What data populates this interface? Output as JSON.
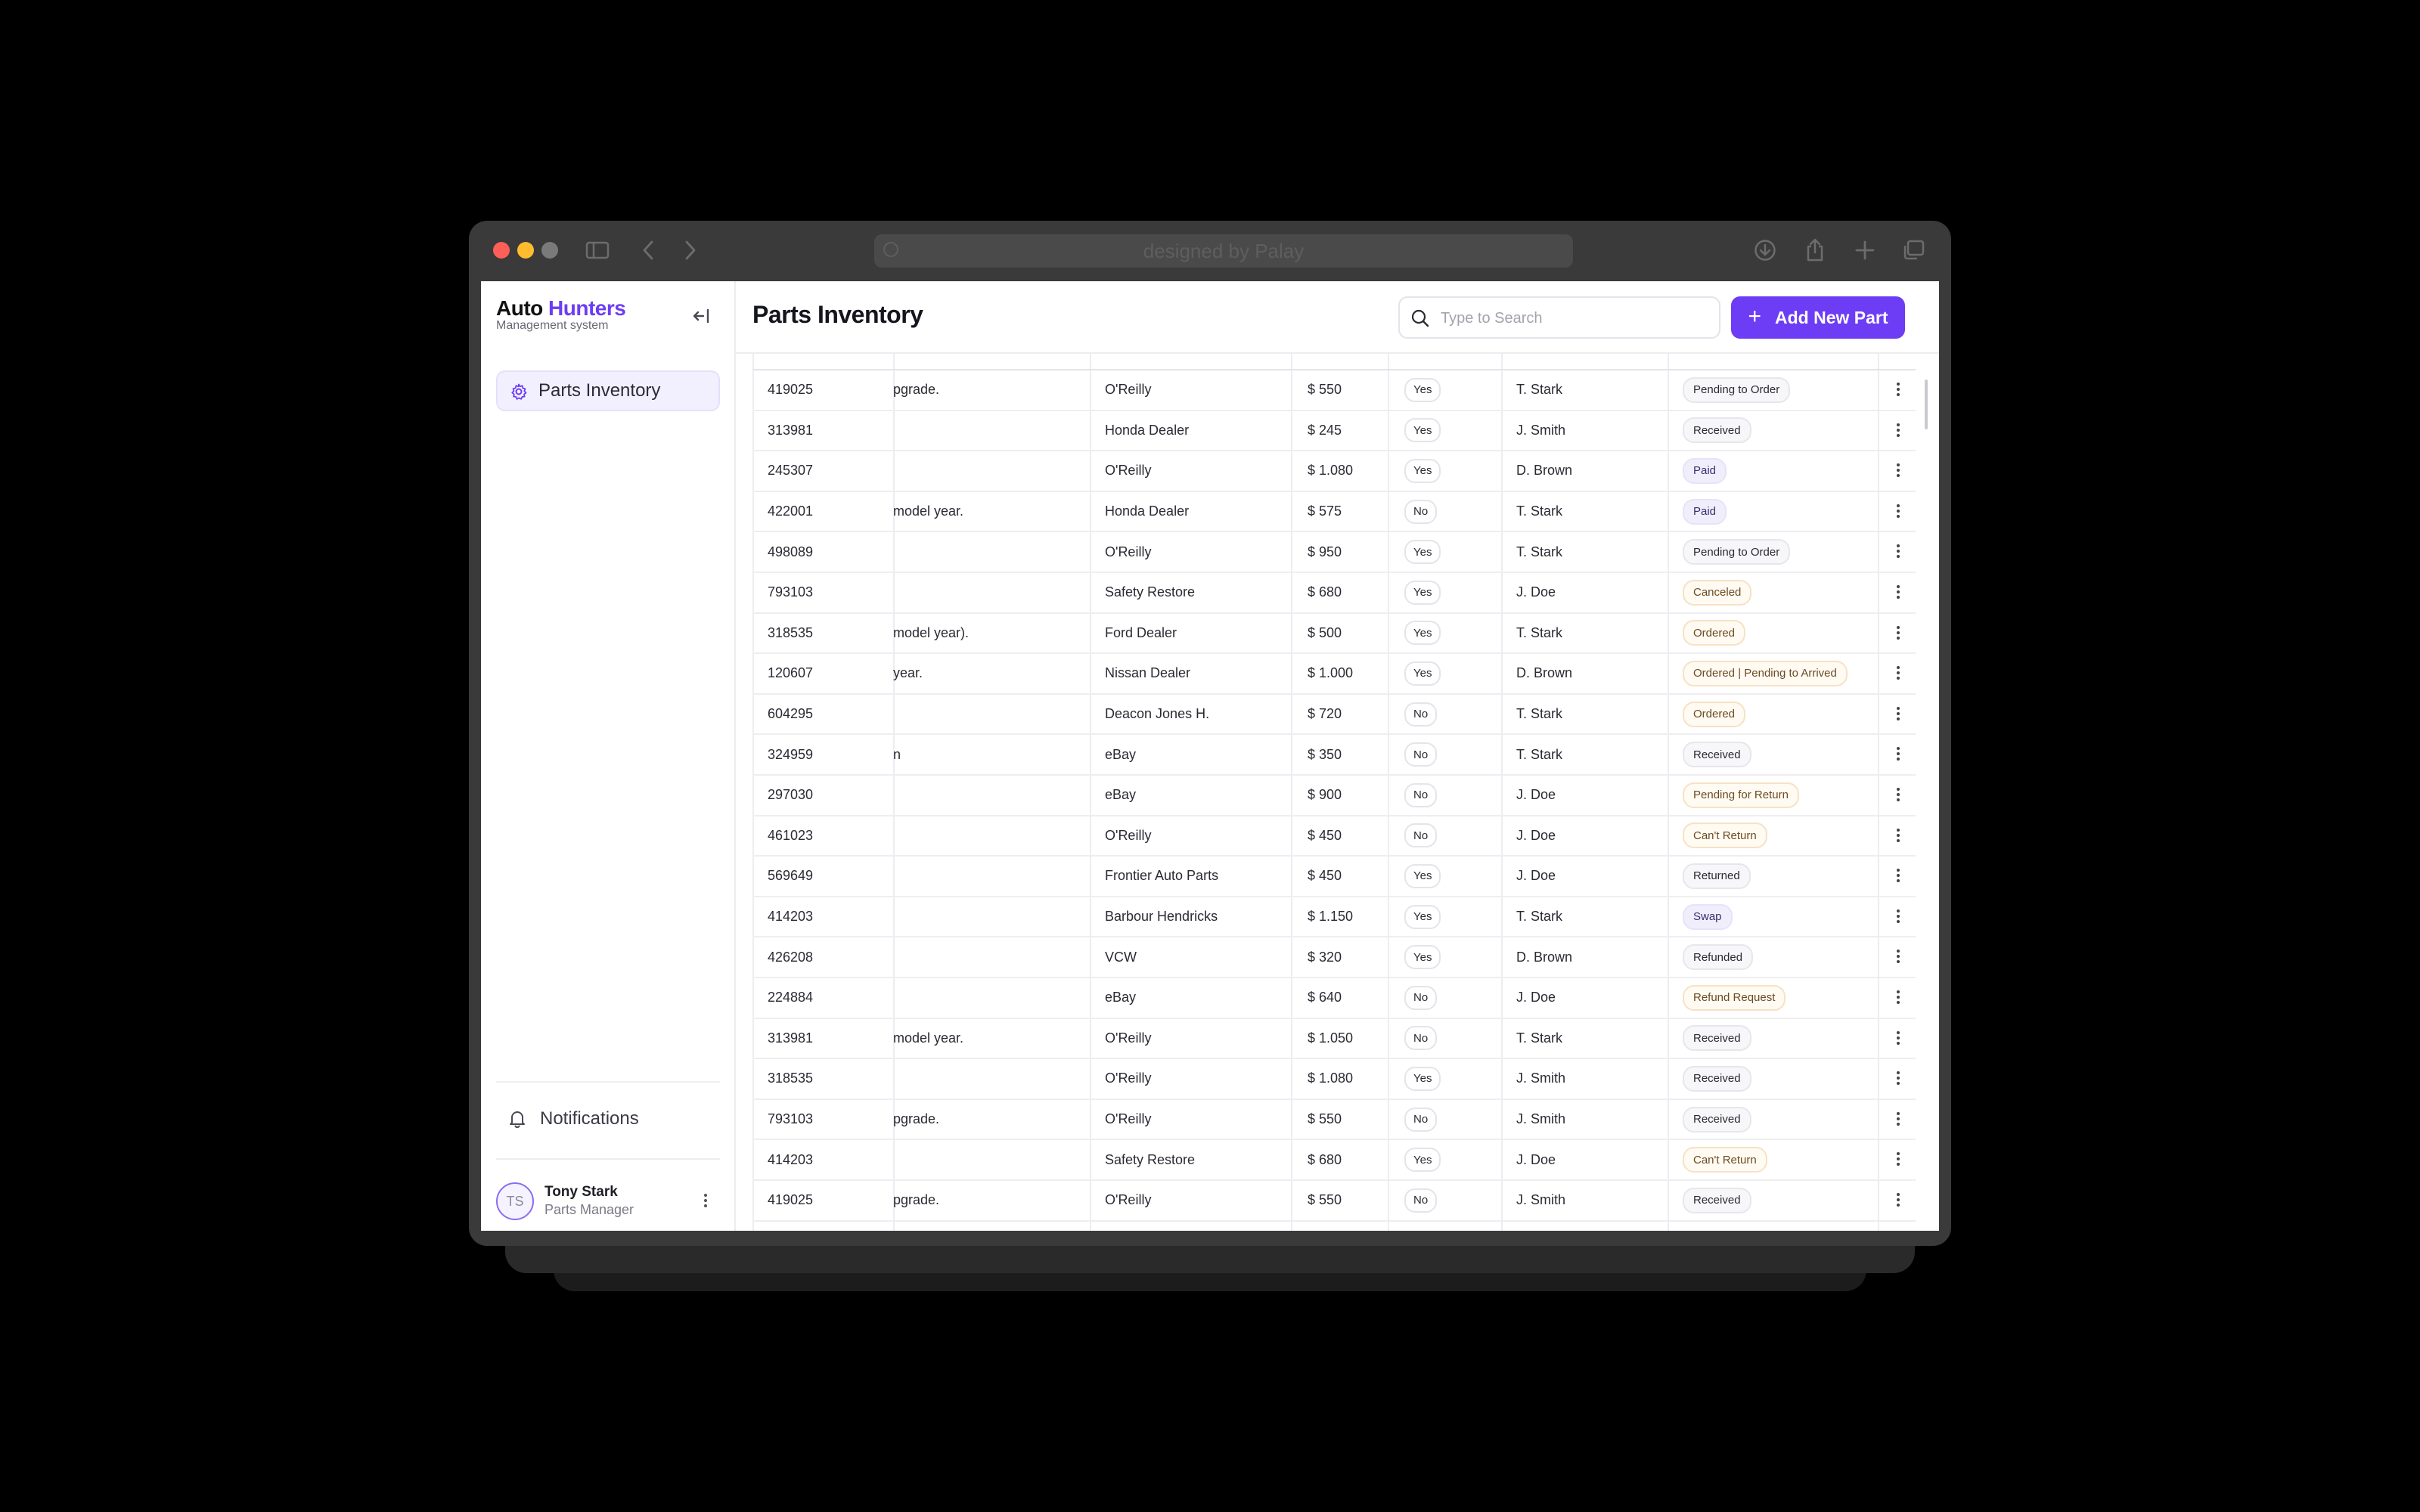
{
  "browser": {
    "url_text": "designed by Palay"
  },
  "app": {
    "brand_part1": "Auto",
    "brand_part2": "Hunters",
    "subtitle": "Management system",
    "accent_color": "#6d3df5"
  },
  "sidebar": {
    "items": [
      {
        "label": "Parts Inventory",
        "icon": "gear-icon"
      }
    ],
    "notifications_label": "Notifications",
    "user": {
      "initials": "TS",
      "name": "Tony Stark",
      "role": "Parts Manager"
    }
  },
  "header": {
    "title": "Parts Inventory",
    "search_placeholder": "Type to Search",
    "add_button_label": "Add New Part"
  },
  "table": {
    "rows": [
      {
        "id": "419025",
        "desc": "pgrade.",
        "supplier": "O'Reilly",
        "price": "$ 550",
        "invoice": "Yes",
        "manager": "T. Stark",
        "status": "Pending to Order",
        "tone": "grey"
      },
      {
        "id": "313981",
        "desc": "",
        "supplier": "Honda Dealer",
        "price": "$ 245",
        "invoice": "Yes",
        "manager": "J. Smith",
        "status": "Received",
        "tone": "grey"
      },
      {
        "id": "245307",
        "desc": "",
        "supplier": "O'Reilly",
        "price": "$ 1.080",
        "invoice": "Yes",
        "manager": "D. Brown",
        "status": "Paid",
        "tone": "purple"
      },
      {
        "id": "422001",
        "desc": "model year.",
        "supplier": "Honda Dealer",
        "price": "$ 575",
        "invoice": "No",
        "manager": "T. Stark",
        "status": "Paid",
        "tone": "purple"
      },
      {
        "id": "498089",
        "desc": "",
        "supplier": "O'Reilly",
        "price": "$ 950",
        "invoice": "Yes",
        "manager": "T. Stark",
        "status": "Pending to Order",
        "tone": "grey"
      },
      {
        "id": "793103",
        "desc": "",
        "supplier": "Safety Restore",
        "price": "$ 680",
        "invoice": "Yes",
        "manager": "J. Doe",
        "status": "Canceled",
        "tone": "orange"
      },
      {
        "id": "318535",
        "desc": "model year).",
        "supplier": "Ford Dealer",
        "price": "$ 500",
        "invoice": "Yes",
        "manager": "T. Stark",
        "status": "Ordered",
        "tone": "orange"
      },
      {
        "id": "120607",
        "desc": "year.",
        "supplier": "Nissan Dealer",
        "price": "$ 1.000",
        "invoice": "Yes",
        "manager": "D. Brown",
        "status": "Ordered | Pending to Arrived",
        "tone": "orange"
      },
      {
        "id": "604295",
        "desc": "",
        "supplier": "Deacon Jones H.",
        "price": "$ 720",
        "invoice": "No",
        "manager": "T. Stark",
        "status": "Ordered",
        "tone": "orange"
      },
      {
        "id": "324959",
        "desc": "n",
        "supplier": "eBay",
        "price": "$ 350",
        "invoice": "No",
        "manager": "T. Stark",
        "status": "Received",
        "tone": "grey"
      },
      {
        "id": "297030",
        "desc": "",
        "supplier": "eBay",
        "price": "$ 900",
        "invoice": "No",
        "manager": "J. Doe",
        "status": "Pending for Return",
        "tone": "orange"
      },
      {
        "id": "461023",
        "desc": "",
        "supplier": "O'Reilly",
        "price": "$ 450",
        "invoice": "No",
        "manager": "J. Doe",
        "status": "Can't Return",
        "tone": "orange"
      },
      {
        "id": "569649",
        "desc": "",
        "supplier": "Frontier Auto Parts",
        "price": "$ 450",
        "invoice": "Yes",
        "manager": "J. Doe",
        "status": "Returned",
        "tone": "grey"
      },
      {
        "id": "414203",
        "desc": "",
        "supplier": "Barbour Hendricks",
        "price": "$ 1.150",
        "invoice": "Yes",
        "manager": "T. Stark",
        "status": "Swap",
        "tone": "purple"
      },
      {
        "id": "426208",
        "desc": "",
        "supplier": "VCW",
        "price": "$ 320",
        "invoice": "Yes",
        "manager": "D. Brown",
        "status": "Refunded",
        "tone": "grey"
      },
      {
        "id": "224884",
        "desc": "",
        "supplier": "eBay",
        "price": "$ 640",
        "invoice": "No",
        "manager": "J. Doe",
        "status": "Refund Request",
        "tone": "orange"
      },
      {
        "id": "313981",
        "desc": "model year.",
        "supplier": "O'Reilly",
        "price": "$ 1.050",
        "invoice": "No",
        "manager": "T. Stark",
        "status": "Received",
        "tone": "grey"
      },
      {
        "id": "318535",
        "desc": "",
        "supplier": "O'Reilly",
        "price": "$ 1.080",
        "invoice": "Yes",
        "manager": "J. Smith",
        "status": "Received",
        "tone": "grey"
      },
      {
        "id": "793103",
        "desc": "pgrade.",
        "supplier": "O'Reilly",
        "price": "$ 550",
        "invoice": "No",
        "manager": "J. Smith",
        "status": "Received",
        "tone": "grey"
      },
      {
        "id": "414203",
        "desc": "",
        "supplier": "Safety Restore",
        "price": "$ 680",
        "invoice": "Yes",
        "manager": "J. Doe",
        "status": "Can't Return",
        "tone": "orange"
      },
      {
        "id": "419025",
        "desc": "pgrade.",
        "supplier": "O'Reilly",
        "price": "$ 550",
        "invoice": "No",
        "manager": "J. Smith",
        "status": "Received",
        "tone": "grey"
      }
    ]
  }
}
